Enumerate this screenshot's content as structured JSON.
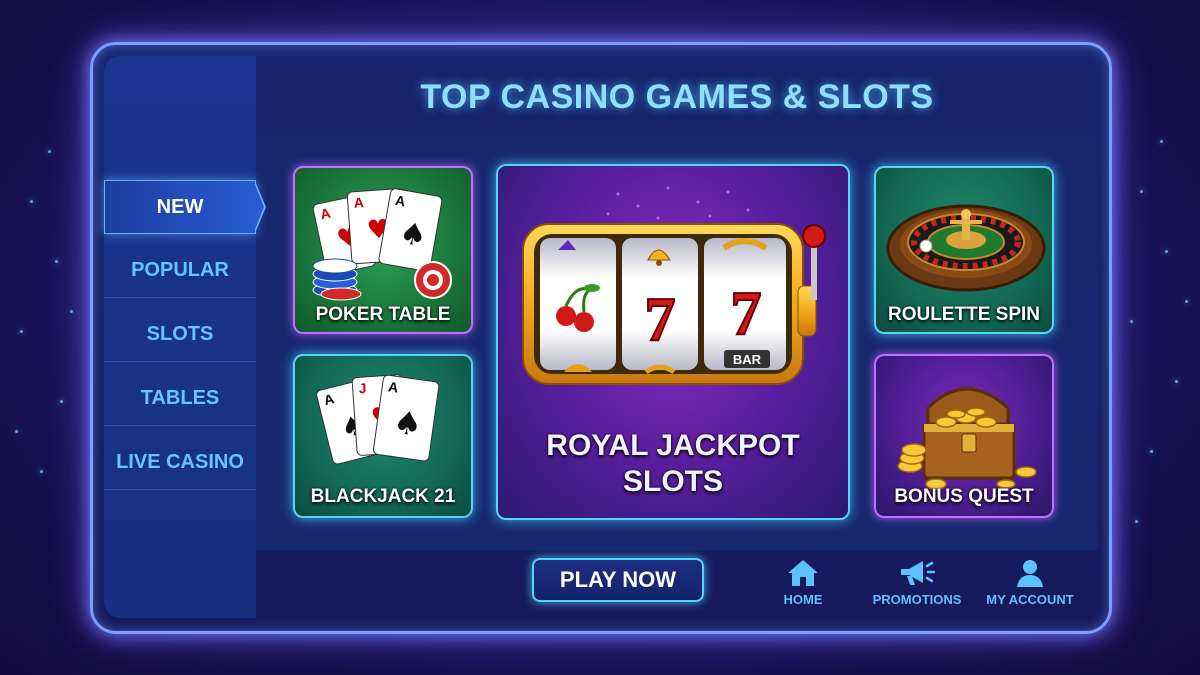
{
  "header": {
    "title": "TOP CASINO GAMES & SLOTS"
  },
  "sidebar": {
    "items": [
      {
        "label": "NEW",
        "active": true
      },
      {
        "label": "POPULAR",
        "active": false
      },
      {
        "label": "SLOTS",
        "active": false
      },
      {
        "label": "TABLES",
        "active": false
      },
      {
        "label": "LIVE CASINO",
        "active": false
      }
    ]
  },
  "games": {
    "poker": {
      "label": "POKER TABLE",
      "icon": "playing-cards-and-chips-icon"
    },
    "blackjack": {
      "label": "BLACKJACK 21",
      "icon": "playing-cards-icon"
    },
    "featured": {
      "line1": "ROYAL JACKPOT",
      "line2": "SLOTS",
      "icon": "slot-machine-icon",
      "reels": [
        "cherry",
        "7",
        "7"
      ],
      "reel_tag": "BAR"
    },
    "roulette": {
      "label": "ROULETTE SPIN",
      "icon": "roulette-wheel-icon"
    },
    "bonus": {
      "label": "BONUS QUEST",
      "icon": "treasure-chest-icon"
    }
  },
  "actions": {
    "play_label": "PLAY NOW"
  },
  "bottom_nav": [
    {
      "label": "HOME",
      "icon": "home-icon"
    },
    {
      "label": "PROMOTIONS",
      "icon": "megaphone-icon"
    },
    {
      "label": "MY ACCOUNT",
      "icon": "user-icon"
    }
  ],
  "colors": {
    "accent_cyan": "#4fd6ff",
    "accent_purple": "#c56bff",
    "title_text": "#8fe0ff",
    "nav_text": "#62c6ff"
  }
}
